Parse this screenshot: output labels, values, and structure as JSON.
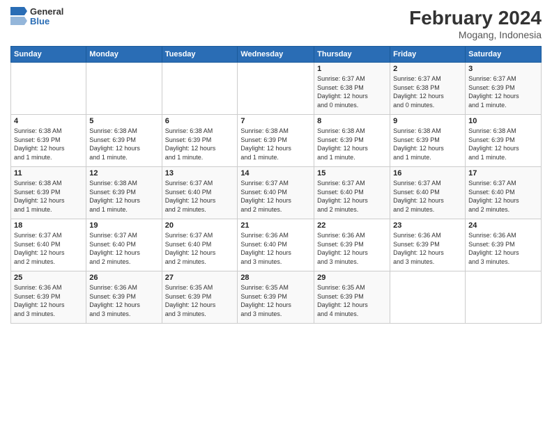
{
  "header": {
    "logo": {
      "general": "General",
      "blue": "Blue"
    },
    "title": "February 2024",
    "location": "Mogang, Indonesia"
  },
  "days_of_week": [
    "Sunday",
    "Monday",
    "Tuesday",
    "Wednesday",
    "Thursday",
    "Friday",
    "Saturday"
  ],
  "weeks": [
    [
      {
        "day": "",
        "info": ""
      },
      {
        "day": "",
        "info": ""
      },
      {
        "day": "",
        "info": ""
      },
      {
        "day": "",
        "info": ""
      },
      {
        "day": "1",
        "info": "Sunrise: 6:37 AM\nSunset: 6:38 PM\nDaylight: 12 hours\nand 0 minutes."
      },
      {
        "day": "2",
        "info": "Sunrise: 6:37 AM\nSunset: 6:38 PM\nDaylight: 12 hours\nand 0 minutes."
      },
      {
        "day": "3",
        "info": "Sunrise: 6:37 AM\nSunset: 6:39 PM\nDaylight: 12 hours\nand 1 minute."
      }
    ],
    [
      {
        "day": "4",
        "info": "Sunrise: 6:38 AM\nSunset: 6:39 PM\nDaylight: 12 hours\nand 1 minute."
      },
      {
        "day": "5",
        "info": "Sunrise: 6:38 AM\nSunset: 6:39 PM\nDaylight: 12 hours\nand 1 minute."
      },
      {
        "day": "6",
        "info": "Sunrise: 6:38 AM\nSunset: 6:39 PM\nDaylight: 12 hours\nand 1 minute."
      },
      {
        "day": "7",
        "info": "Sunrise: 6:38 AM\nSunset: 6:39 PM\nDaylight: 12 hours\nand 1 minute."
      },
      {
        "day": "8",
        "info": "Sunrise: 6:38 AM\nSunset: 6:39 PM\nDaylight: 12 hours\nand 1 minute."
      },
      {
        "day": "9",
        "info": "Sunrise: 6:38 AM\nSunset: 6:39 PM\nDaylight: 12 hours\nand 1 minute."
      },
      {
        "day": "10",
        "info": "Sunrise: 6:38 AM\nSunset: 6:39 PM\nDaylight: 12 hours\nand 1 minute."
      }
    ],
    [
      {
        "day": "11",
        "info": "Sunrise: 6:38 AM\nSunset: 6:39 PM\nDaylight: 12 hours\nand 1 minute."
      },
      {
        "day": "12",
        "info": "Sunrise: 6:38 AM\nSunset: 6:39 PM\nDaylight: 12 hours\nand 1 minute."
      },
      {
        "day": "13",
        "info": "Sunrise: 6:37 AM\nSunset: 6:40 PM\nDaylight: 12 hours\nand 2 minutes."
      },
      {
        "day": "14",
        "info": "Sunrise: 6:37 AM\nSunset: 6:40 PM\nDaylight: 12 hours\nand 2 minutes."
      },
      {
        "day": "15",
        "info": "Sunrise: 6:37 AM\nSunset: 6:40 PM\nDaylight: 12 hours\nand 2 minutes."
      },
      {
        "day": "16",
        "info": "Sunrise: 6:37 AM\nSunset: 6:40 PM\nDaylight: 12 hours\nand 2 minutes."
      },
      {
        "day": "17",
        "info": "Sunrise: 6:37 AM\nSunset: 6:40 PM\nDaylight: 12 hours\nand 2 minutes."
      }
    ],
    [
      {
        "day": "18",
        "info": "Sunrise: 6:37 AM\nSunset: 6:40 PM\nDaylight: 12 hours\nand 2 minutes."
      },
      {
        "day": "19",
        "info": "Sunrise: 6:37 AM\nSunset: 6:40 PM\nDaylight: 12 hours\nand 2 minutes."
      },
      {
        "day": "20",
        "info": "Sunrise: 6:37 AM\nSunset: 6:40 PM\nDaylight: 12 hours\nand 2 minutes."
      },
      {
        "day": "21",
        "info": "Sunrise: 6:36 AM\nSunset: 6:40 PM\nDaylight: 12 hours\nand 3 minutes."
      },
      {
        "day": "22",
        "info": "Sunrise: 6:36 AM\nSunset: 6:39 PM\nDaylight: 12 hours\nand 3 minutes."
      },
      {
        "day": "23",
        "info": "Sunrise: 6:36 AM\nSunset: 6:39 PM\nDaylight: 12 hours\nand 3 minutes."
      },
      {
        "day": "24",
        "info": "Sunrise: 6:36 AM\nSunset: 6:39 PM\nDaylight: 12 hours\nand 3 minutes."
      }
    ],
    [
      {
        "day": "25",
        "info": "Sunrise: 6:36 AM\nSunset: 6:39 PM\nDaylight: 12 hours\nand 3 minutes."
      },
      {
        "day": "26",
        "info": "Sunrise: 6:36 AM\nSunset: 6:39 PM\nDaylight: 12 hours\nand 3 minutes."
      },
      {
        "day": "27",
        "info": "Sunrise: 6:35 AM\nSunset: 6:39 PM\nDaylight: 12 hours\nand 3 minutes."
      },
      {
        "day": "28",
        "info": "Sunrise: 6:35 AM\nSunset: 6:39 PM\nDaylight: 12 hours\nand 3 minutes."
      },
      {
        "day": "29",
        "info": "Sunrise: 6:35 AM\nSunset: 6:39 PM\nDaylight: 12 hours\nand 4 minutes."
      },
      {
        "day": "",
        "info": ""
      },
      {
        "day": "",
        "info": ""
      }
    ]
  ]
}
